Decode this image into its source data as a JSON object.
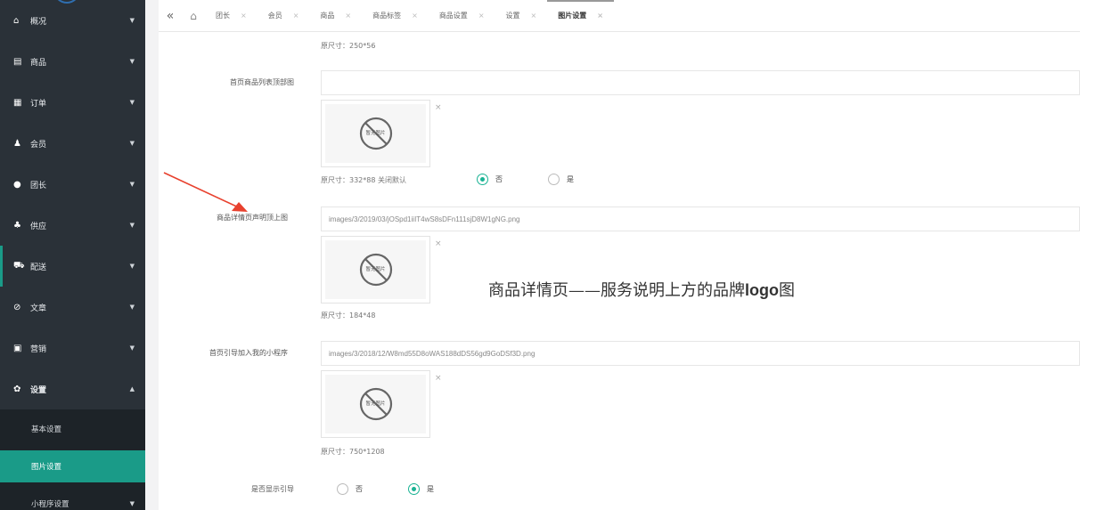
{
  "sidebar": {
    "items": [
      {
        "icon": "home-icon",
        "glyph": "⌂",
        "label": "概况"
      },
      {
        "icon": "product-icon",
        "glyph": "▤",
        "label": "商品"
      },
      {
        "icon": "order-icon",
        "glyph": "▦",
        "label": "订单"
      },
      {
        "icon": "member-icon",
        "glyph": "♟",
        "label": "会员"
      },
      {
        "icon": "leader-icon",
        "glyph": "●",
        "label": "团长"
      },
      {
        "icon": "supplier-icon",
        "glyph": "♣",
        "label": "供应"
      },
      {
        "icon": "delivery-icon",
        "glyph": "⛟",
        "label": "配送"
      },
      {
        "icon": "article-icon",
        "glyph": "⊘",
        "label": "文章"
      },
      {
        "icon": "marketing-icon",
        "glyph": "▣",
        "label": "营销"
      },
      {
        "icon": "settings-icon",
        "glyph": "✿",
        "label": "设置"
      }
    ],
    "subitems": [
      {
        "label": "基本设置"
      },
      {
        "label": "图片设置"
      },
      {
        "label": "小程序设置"
      }
    ],
    "accent_color": "#1a9b88"
  },
  "tabs": [
    {
      "label": "团长"
    },
    {
      "label": "会员"
    },
    {
      "label": "商品"
    },
    {
      "label": "商品标签"
    },
    {
      "label": "商品设置"
    },
    {
      "label": "设置"
    },
    {
      "label": "图片设置"
    }
  ],
  "tab_close": "×",
  "tab_back_glyph": "«",
  "tab_home_glyph": "⌂",
  "form": {
    "top_note": "原尺寸：250*56",
    "field1": {
      "label": "首页商品列表顶部图",
      "value": "",
      "note": "原尺寸：332*88  关闭默认"
    },
    "field1_radio": {
      "no": "否",
      "yes": "是"
    },
    "field2": {
      "label": "商品详情页声明顶上图",
      "value": "images/3/2019/03/jOSpd1iiIT4wS8sDFn111sjD8W1gNG.png",
      "note": "原尺寸：184*48"
    },
    "field3": {
      "label": "首页引导加入我的小程序",
      "value": "images/3/2018/12/W8md55D8oWAS188dDS56gd9GoDSf3D.png",
      "note": "原尺寸：750*1208"
    },
    "field4": {
      "label": "是否显示引导",
      "no": "否",
      "yes": "是"
    },
    "noimg_label": "暂无图片",
    "remove_glyph": "×"
  },
  "annotation": {
    "text_cn": "商品详情页——服务说明上方的品牌",
    "text_latin": "logo",
    "text_end": "图"
  },
  "colors": {
    "sidebar_bg": "#2a3138",
    "radio_accent": "#1ab394",
    "arrow": "#e8412e"
  }
}
